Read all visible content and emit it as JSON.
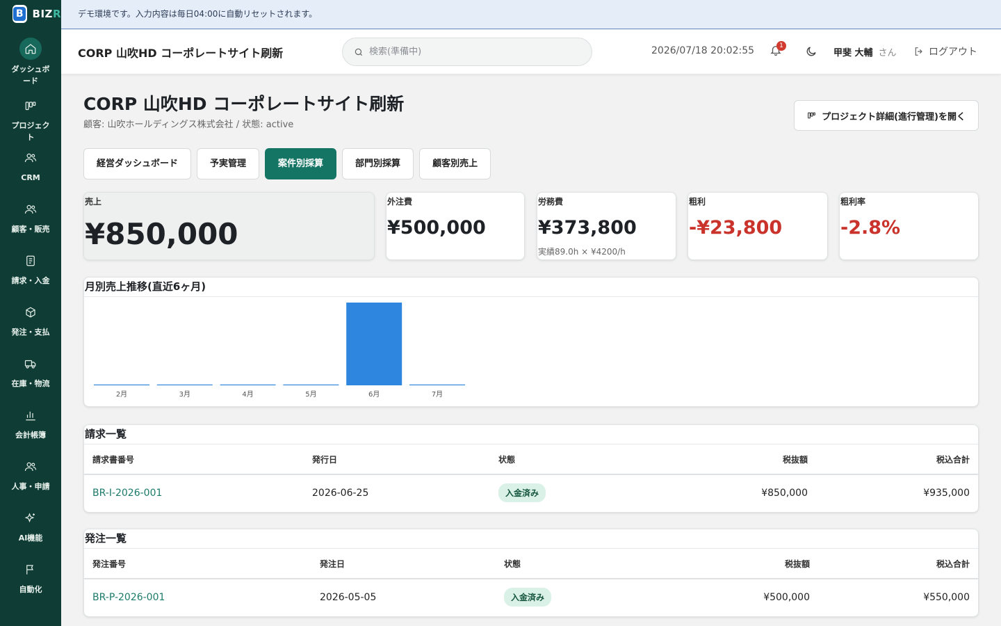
{
  "app": {
    "logo_text": "BIZ",
    "logo_text_tail": "R"
  },
  "sidebar": {
    "items": [
      {
        "label": "ダッシュボード",
        "icon": "home-icon",
        "active": true
      },
      {
        "label": "プロジェクト",
        "icon": "kanban-icon"
      },
      {
        "label": "CRM",
        "icon": "users-icon"
      },
      {
        "label": "顧客・販売",
        "icon": "users-icon"
      },
      {
        "label": "請求・入金",
        "icon": "document-icon"
      },
      {
        "label": "発注・支払",
        "icon": "box-icon"
      },
      {
        "label": "在庫・物流",
        "icon": "truck-icon"
      },
      {
        "label": "会計帳簿",
        "icon": "bar-chart-icon"
      },
      {
        "label": "人事・申請",
        "icon": "users-icon"
      },
      {
        "label": "AI機能",
        "icon": "sparkles-icon"
      },
      {
        "label": "自動化",
        "icon": "flag-icon"
      }
    ]
  },
  "banner": {
    "text": "デモ環境です。入力内容は毎日04:00に自動リセットされます。"
  },
  "header": {
    "title": "CORP 山吹HD コーポレートサイト刷新",
    "search_placeholder": "検索(準備中)",
    "datetime": "2026/07/18 20:02:55",
    "notification_count": "1",
    "user_name": "甲斐 大輔",
    "user_suffix": "さん",
    "logout_label": "ログアウト"
  },
  "page": {
    "title": "CORP 山吹HD コーポレートサイト刷新",
    "subtitle": "顧客: 山吹ホールディングス株式会社 / 状態: active",
    "open_button": "プロジェクト詳細(進行管理)を開く"
  },
  "tabs": [
    {
      "label": "経営ダッシュボード"
    },
    {
      "label": "予実管理"
    },
    {
      "label": "案件別採算",
      "active": true
    },
    {
      "label": "部門別採算"
    },
    {
      "label": "顧客別売上"
    }
  ],
  "kpis": {
    "sales": {
      "label": "売上",
      "value": "¥850,000"
    },
    "outsourcing": {
      "label": "外注費",
      "value": "¥500,000"
    },
    "labor": {
      "label": "労務費",
      "value": "¥373,800",
      "note": "実績89.0h × ¥4200/h"
    },
    "gross_profit": {
      "label": "粗利",
      "value": "-¥23,800"
    },
    "gross_margin": {
      "label": "粗利率",
      "value": "-2.8%"
    }
  },
  "chart_data": {
    "type": "bar",
    "title": "月別売上推移(直近6ヶ月)",
    "categories": [
      "2月",
      "3月",
      "4月",
      "5月",
      "6月",
      "7月"
    ],
    "values": [
      0,
      0,
      0,
      0,
      850000,
      0
    ],
    "ylim": [
      0,
      850000
    ],
    "color": "#2e86de",
    "grid": false,
    "legend": "none"
  },
  "invoices": {
    "title": "請求一覧",
    "columns": [
      "請求書番号",
      "発行日",
      "状態",
      "税抜額",
      "税込合計"
    ],
    "rows": [
      {
        "number": "BR-I-2026-001",
        "date": "2026-06-25",
        "status": "入金済み",
        "net": "¥850,000",
        "gross": "¥935,000"
      }
    ]
  },
  "orders": {
    "title": "発注一覧",
    "columns": [
      "発注番号",
      "発注日",
      "状態",
      "税抜額",
      "税込合計"
    ],
    "rows": [
      {
        "number": "BR-P-2026-001",
        "date": "2026-05-05",
        "status": "入金済み",
        "net": "¥500,000",
        "gross": "¥550,000"
      }
    ]
  },
  "colors": {
    "sidebar": "#0f3d35",
    "accent": "#157565",
    "negative": "#c9332b",
    "bar": "#2e86de"
  }
}
